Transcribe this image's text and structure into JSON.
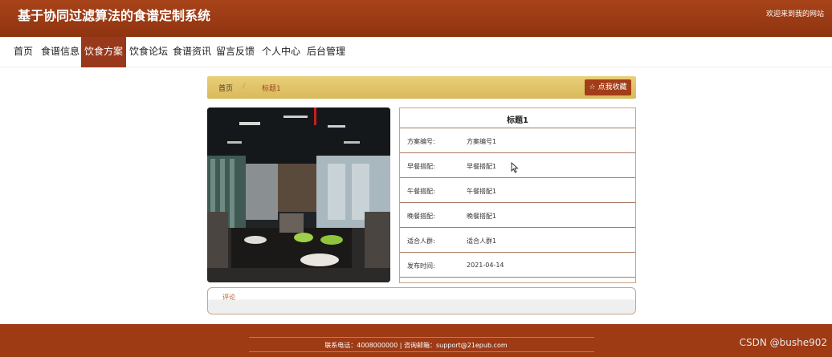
{
  "header": {
    "site_title": "基于协同过滤算法的食谱定制系统",
    "welcome": "欢迎来到我的网站"
  },
  "nav": {
    "items": [
      {
        "label": "首页"
      },
      {
        "label": "食谱信息"
      },
      {
        "label": "饮食方案",
        "active": true
      },
      {
        "label": "饮食论坛"
      },
      {
        "label": "食谱资讯"
      },
      {
        "label": "留言反馈"
      },
      {
        "label": "个人中心"
      },
      {
        "label": "后台管理"
      }
    ]
  },
  "breadcrumb": {
    "home": "首页",
    "separator": "/",
    "current": "标题1"
  },
  "favorite_button": "☆ 点我收藏",
  "detail": {
    "title": "标题1",
    "rows": [
      {
        "label": "方案编号:",
        "value": "方案编号1"
      },
      {
        "label": "早餐搭配:",
        "value": "早餐搭配1"
      },
      {
        "label": "午餐搭配:",
        "value": "午餐搭配1"
      },
      {
        "label": "晚餐搭配:",
        "value": "晚餐搭配1"
      },
      {
        "label": "适合人群:",
        "value": "适合人群1"
      },
      {
        "label": "发布时间:",
        "value": "2021-04-14"
      }
    ]
  },
  "comment": {
    "label": "评论"
  },
  "footer": {
    "contact": "联系电话：4008000000 | 咨询邮箱：support@21epub.com",
    "watermark": "CSDN @bushe902"
  },
  "colors": {
    "brand": "#99391b",
    "breadcrumb_bg": "#e3c56c",
    "border": "#c7a58a"
  }
}
